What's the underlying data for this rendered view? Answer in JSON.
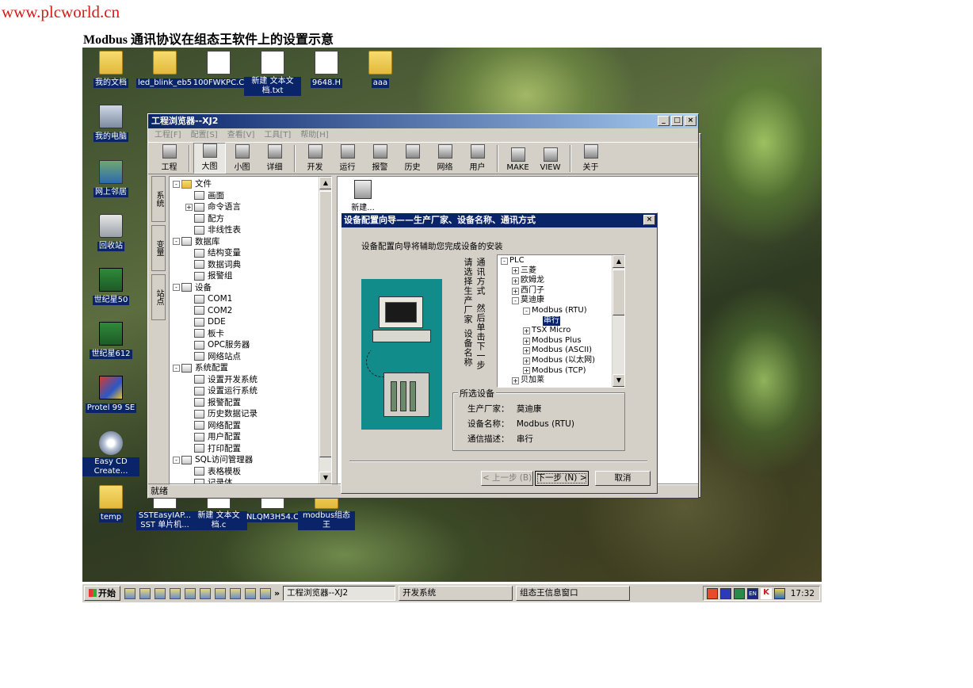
{
  "header": {
    "site": "www.plcworld.cn",
    "caption": "Modbus 通讯协议在组态王软件上的设置示意"
  },
  "desktop": {
    "icons": [
      {
        "label": "我的文档",
        "kind": "folder"
      },
      {
        "label": "led_blink_eb55",
        "kind": "folder"
      },
      {
        "label": "100FWKPC.C",
        "kind": "doc"
      },
      {
        "label": "新建 文本文档.txt",
        "kind": "doc"
      },
      {
        "label": "9648.H",
        "kind": "doc"
      },
      {
        "label": "aaa",
        "kind": "folder"
      },
      {
        "label": "我的电脑",
        "kind": "pc"
      },
      {
        "label": "网上邻居",
        "kind": "net"
      },
      {
        "label": "回收站",
        "kind": "bin"
      },
      {
        "label": "世纪星50",
        "kind": "app"
      },
      {
        "label": "世纪星612",
        "kind": "app"
      },
      {
        "label": "Protel 99 SE",
        "kind": "protel"
      },
      {
        "label": "Easy CD Create...",
        "kind": "cd"
      },
      {
        "label": "temp",
        "kind": "folder"
      },
      {
        "label": "SSTEasyIAP... SST 单片机...",
        "kind": "doc"
      },
      {
        "label": "新建 文本文档.c",
        "kind": "doc"
      },
      {
        "label": "NLQM3H54.C",
        "kind": "doc"
      },
      {
        "label": "modbus组态王",
        "kind": "folder"
      }
    ]
  },
  "main_window": {
    "title": "工程浏览器--XJ2",
    "menu": [
      "工程[F]",
      "配置[S]",
      "查看[V]",
      "工具[T]",
      "帮助[H]"
    ],
    "toolbar": [
      "工程",
      "大图",
      "小图",
      "详细",
      "开发",
      "运行",
      "报警",
      "历史",
      "网络",
      "用户",
      "MAKE",
      "VIEW",
      "关于"
    ],
    "side_tabs": [
      "系统",
      "变量",
      "站点"
    ],
    "tree": [
      {
        "level": 0,
        "exp": "-",
        "icon": "fold",
        "label": "文件"
      },
      {
        "level": 1,
        "exp": "",
        "icon": "item",
        "label": "画面"
      },
      {
        "level": 1,
        "exp": "+",
        "icon": "item",
        "label": "命令语言"
      },
      {
        "level": 1,
        "exp": "",
        "icon": "item",
        "label": "配方"
      },
      {
        "level": 1,
        "exp": "",
        "icon": "item",
        "label": "非线性表"
      },
      {
        "level": 0,
        "exp": "-",
        "icon": "item",
        "label": "数据库"
      },
      {
        "level": 1,
        "exp": "",
        "icon": "item",
        "label": "结构变量"
      },
      {
        "level": 1,
        "exp": "",
        "icon": "item",
        "label": "数据词典"
      },
      {
        "level": 1,
        "exp": "",
        "icon": "item",
        "label": "报警组"
      },
      {
        "level": 0,
        "exp": "-",
        "icon": "item",
        "label": "设备"
      },
      {
        "level": 1,
        "exp": "",
        "icon": "item",
        "label": "COM1"
      },
      {
        "level": 1,
        "exp": "",
        "icon": "item",
        "label": "COM2"
      },
      {
        "level": 1,
        "exp": "",
        "icon": "item",
        "label": "DDE"
      },
      {
        "level": 1,
        "exp": "",
        "icon": "item",
        "label": "板卡"
      },
      {
        "level": 1,
        "exp": "",
        "icon": "item",
        "label": "OPC服务器"
      },
      {
        "level": 1,
        "exp": "",
        "icon": "item",
        "label": "网络站点"
      },
      {
        "level": 0,
        "exp": "-",
        "icon": "item",
        "label": "系统配置"
      },
      {
        "level": 1,
        "exp": "",
        "icon": "item",
        "label": "设置开发系统"
      },
      {
        "level": 1,
        "exp": "",
        "icon": "item",
        "label": "设置运行系统"
      },
      {
        "level": 1,
        "exp": "",
        "icon": "item",
        "label": "报警配置"
      },
      {
        "level": 1,
        "exp": "",
        "icon": "item",
        "label": "历史数据记录"
      },
      {
        "level": 1,
        "exp": "",
        "icon": "item",
        "label": "网络配置"
      },
      {
        "level": 1,
        "exp": "",
        "icon": "item",
        "label": "用户配置"
      },
      {
        "level": 1,
        "exp": "",
        "icon": "item",
        "label": "打印配置"
      },
      {
        "level": 0,
        "exp": "-",
        "icon": "item",
        "label": "SQL访问管理器"
      },
      {
        "level": 1,
        "exp": "",
        "icon": "item",
        "label": "表格模板"
      },
      {
        "level": 1,
        "exp": "",
        "icon": "item",
        "label": "记录体"
      }
    ],
    "content_item": "新建...",
    "status": "就绪"
  },
  "dialog": {
    "title": "设备配置向导——生产厂家、设备名称、通讯方式",
    "intro": "设备配置向导将辅助您完成设备的安装",
    "instr_col1": "通讯方式",
    "instr_col2": "请选择生产厂家",
    "instr_col3": "然后单击下一步",
    "instr_col4": "设备名称",
    "tree": [
      {
        "level": 0,
        "exp": "-",
        "label": "PLC",
        "sel": false
      },
      {
        "level": 1,
        "exp": "+",
        "label": "三菱",
        "sel": false
      },
      {
        "level": 1,
        "exp": "+",
        "label": "欧姆龙",
        "sel": false
      },
      {
        "level": 1,
        "exp": "+",
        "label": "西门子",
        "sel": false
      },
      {
        "level": 1,
        "exp": "-",
        "label": "莫迪康",
        "sel": false
      },
      {
        "level": 2,
        "exp": "-",
        "label": "Modbus (RTU)",
        "sel": false
      },
      {
        "level": 3,
        "exp": "",
        "label": "串行",
        "sel": true
      },
      {
        "level": 2,
        "exp": "+",
        "label": "TSX Micro",
        "sel": false
      },
      {
        "level": 2,
        "exp": "+",
        "label": "Modbus Plus",
        "sel": false
      },
      {
        "level": 2,
        "exp": "+",
        "label": "Modbus (ASCII)",
        "sel": false
      },
      {
        "level": 2,
        "exp": "+",
        "label": "Modbus (以太网)",
        "sel": false
      },
      {
        "level": 2,
        "exp": "+",
        "label": "Modbus (TCP)",
        "sel": false
      },
      {
        "level": 1,
        "exp": "+",
        "label": "贝加莱",
        "sel": false
      }
    ],
    "selected_group": {
      "legend": "所选设备",
      "vendor_label": "生产厂家：",
      "vendor": "莫迪康",
      "device_label": "设备名称：",
      "device": "Modbus (RTU)",
      "comm_label": "通信描述：",
      "comm": "串行"
    },
    "buttons": {
      "prev": "< 上一步 (B)",
      "next": "下一步 (N) >",
      "cancel": "取消"
    }
  },
  "info_window": {
    "title": ""
  },
  "taskbar": {
    "start": "开始",
    "more": "»",
    "tasks": [
      "工程浏览器--XJ2",
      "开发系统",
      "组态王信息窗口"
    ],
    "clock": "17:32",
    "tray_en": "EN",
    "tray_k": "K"
  }
}
